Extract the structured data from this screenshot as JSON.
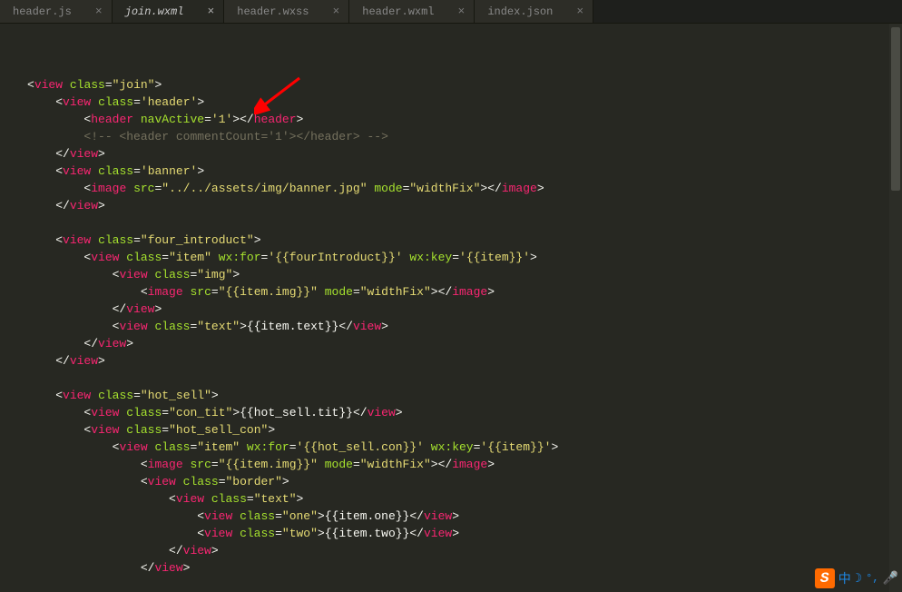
{
  "tabs": [
    {
      "label": "header.js",
      "active": false
    },
    {
      "label": "join.wxml",
      "active": true
    },
    {
      "label": "header.wxss",
      "active": false
    },
    {
      "label": "header.wxml",
      "active": false
    },
    {
      "label": "index.json",
      "active": false
    }
  ],
  "code_lines": [
    {
      "indent": 0,
      "tokens": [
        {
          "t": "tag-angle",
          "v": "<"
        },
        {
          "t": "tag-name",
          "v": "view"
        },
        {
          "t": "text",
          "v": " "
        },
        {
          "t": "attr-name",
          "v": "class"
        },
        {
          "t": "eq",
          "v": "="
        },
        {
          "t": "string",
          "v": "\"join\""
        },
        {
          "t": "tag-angle",
          "v": ">"
        }
      ]
    },
    {
      "indent": 1,
      "tokens": [
        {
          "t": "tag-angle",
          "v": "<"
        },
        {
          "t": "tag-name",
          "v": "view"
        },
        {
          "t": "text",
          "v": " "
        },
        {
          "t": "attr-name",
          "v": "class"
        },
        {
          "t": "eq",
          "v": "="
        },
        {
          "t": "string",
          "v": "'header'"
        },
        {
          "t": "tag-angle",
          "v": ">"
        }
      ]
    },
    {
      "indent": 2,
      "tokens": [
        {
          "t": "tag-angle",
          "v": "<"
        },
        {
          "t": "tag-name",
          "v": "header"
        },
        {
          "t": "text",
          "v": " "
        },
        {
          "t": "attr-name",
          "v": "navActive"
        },
        {
          "t": "eq",
          "v": "="
        },
        {
          "t": "string",
          "v": "'1'"
        },
        {
          "t": "tag-angle",
          "v": ">"
        },
        {
          "t": "tag-angle",
          "v": "</"
        },
        {
          "t": "tag-name",
          "v": "header"
        },
        {
          "t": "tag-angle",
          "v": ">"
        }
      ]
    },
    {
      "indent": 2,
      "tokens": [
        {
          "t": "comment",
          "v": "<!-- <header commentCount='1'></header> -->"
        }
      ]
    },
    {
      "indent": 1,
      "tokens": [
        {
          "t": "tag-angle",
          "v": "</"
        },
        {
          "t": "tag-name",
          "v": "view"
        },
        {
          "t": "tag-angle",
          "v": ">"
        }
      ]
    },
    {
      "indent": 1,
      "tokens": [
        {
          "t": "tag-angle",
          "v": "<"
        },
        {
          "t": "tag-name",
          "v": "view"
        },
        {
          "t": "text",
          "v": " "
        },
        {
          "t": "attr-name",
          "v": "class"
        },
        {
          "t": "eq",
          "v": "="
        },
        {
          "t": "string",
          "v": "'banner'"
        },
        {
          "t": "tag-angle",
          "v": ">"
        }
      ]
    },
    {
      "indent": 2,
      "tokens": [
        {
          "t": "tag-angle",
          "v": "<"
        },
        {
          "t": "tag-name",
          "v": "image"
        },
        {
          "t": "text",
          "v": " "
        },
        {
          "t": "attr-name",
          "v": "src"
        },
        {
          "t": "eq",
          "v": "="
        },
        {
          "t": "string",
          "v": "\"../../assets/img/banner.jpg\""
        },
        {
          "t": "text",
          "v": " "
        },
        {
          "t": "attr-name",
          "v": "mode"
        },
        {
          "t": "eq",
          "v": "="
        },
        {
          "t": "string",
          "v": "\"widthFix\""
        },
        {
          "t": "tag-angle",
          "v": ">"
        },
        {
          "t": "tag-angle",
          "v": "</"
        },
        {
          "t": "tag-name",
          "v": "image"
        },
        {
          "t": "tag-angle",
          "v": ">"
        }
      ]
    },
    {
      "indent": 1,
      "tokens": [
        {
          "t": "tag-angle",
          "v": "</"
        },
        {
          "t": "tag-name",
          "v": "view"
        },
        {
          "t": "tag-angle",
          "v": ">"
        }
      ]
    },
    {
      "indent": 0,
      "tokens": []
    },
    {
      "indent": 1,
      "tokens": [
        {
          "t": "tag-angle",
          "v": "<"
        },
        {
          "t": "tag-name",
          "v": "view"
        },
        {
          "t": "text",
          "v": " "
        },
        {
          "t": "attr-name",
          "v": "class"
        },
        {
          "t": "eq",
          "v": "="
        },
        {
          "t": "string",
          "v": "\"four_introduct\""
        },
        {
          "t": "tag-angle",
          "v": ">"
        }
      ]
    },
    {
      "indent": 2,
      "tokens": [
        {
          "t": "tag-angle",
          "v": "<"
        },
        {
          "t": "tag-name",
          "v": "view"
        },
        {
          "t": "text",
          "v": " "
        },
        {
          "t": "attr-name",
          "v": "class"
        },
        {
          "t": "eq",
          "v": "="
        },
        {
          "t": "string",
          "v": "\"item\""
        },
        {
          "t": "text",
          "v": " "
        },
        {
          "t": "attr-name",
          "v": "wx:for"
        },
        {
          "t": "eq",
          "v": "="
        },
        {
          "t": "string",
          "v": "'{{fourIntroduct}}'"
        },
        {
          "t": "text",
          "v": " "
        },
        {
          "t": "attr-name",
          "v": "wx:key"
        },
        {
          "t": "eq",
          "v": "="
        },
        {
          "t": "string",
          "v": "'{{item}}'"
        },
        {
          "t": "tag-angle",
          "v": ">"
        }
      ]
    },
    {
      "indent": 3,
      "tokens": [
        {
          "t": "tag-angle",
          "v": "<"
        },
        {
          "t": "tag-name",
          "v": "view"
        },
        {
          "t": "text",
          "v": " "
        },
        {
          "t": "attr-name",
          "v": "class"
        },
        {
          "t": "eq",
          "v": "="
        },
        {
          "t": "string",
          "v": "\"img\""
        },
        {
          "t": "tag-angle",
          "v": ">"
        }
      ]
    },
    {
      "indent": 4,
      "tokens": [
        {
          "t": "tag-angle",
          "v": "<"
        },
        {
          "t": "tag-name",
          "v": "image"
        },
        {
          "t": "text",
          "v": " "
        },
        {
          "t": "attr-name",
          "v": "src"
        },
        {
          "t": "eq",
          "v": "="
        },
        {
          "t": "string",
          "v": "\"{{item.img}}\""
        },
        {
          "t": "text",
          "v": " "
        },
        {
          "t": "attr-name",
          "v": "mode"
        },
        {
          "t": "eq",
          "v": "="
        },
        {
          "t": "string",
          "v": "\"widthFix\""
        },
        {
          "t": "tag-angle",
          "v": ">"
        },
        {
          "t": "tag-angle",
          "v": "</"
        },
        {
          "t": "tag-name",
          "v": "image"
        },
        {
          "t": "tag-angle",
          "v": ">"
        }
      ]
    },
    {
      "indent": 3,
      "tokens": [
        {
          "t": "tag-angle",
          "v": "</"
        },
        {
          "t": "tag-name",
          "v": "view"
        },
        {
          "t": "tag-angle",
          "v": ">"
        }
      ]
    },
    {
      "indent": 3,
      "tokens": [
        {
          "t": "tag-angle",
          "v": "<"
        },
        {
          "t": "tag-name",
          "v": "view"
        },
        {
          "t": "text",
          "v": " "
        },
        {
          "t": "attr-name",
          "v": "class"
        },
        {
          "t": "eq",
          "v": "="
        },
        {
          "t": "string",
          "v": "\"text\""
        },
        {
          "t": "tag-angle",
          "v": ">"
        },
        {
          "t": "mustache",
          "v": "{{item.text}}"
        },
        {
          "t": "tag-angle",
          "v": "</"
        },
        {
          "t": "tag-name",
          "v": "view"
        },
        {
          "t": "tag-angle",
          "v": ">"
        }
      ]
    },
    {
      "indent": 2,
      "tokens": [
        {
          "t": "tag-angle",
          "v": "</"
        },
        {
          "t": "tag-name",
          "v": "view"
        },
        {
          "t": "tag-angle",
          "v": ">"
        }
      ]
    },
    {
      "indent": 1,
      "tokens": [
        {
          "t": "tag-angle",
          "v": "</"
        },
        {
          "t": "tag-name",
          "v": "view"
        },
        {
          "t": "tag-angle",
          "v": ">"
        }
      ]
    },
    {
      "indent": 0,
      "tokens": []
    },
    {
      "indent": 1,
      "tokens": [
        {
          "t": "tag-angle",
          "v": "<"
        },
        {
          "t": "tag-name",
          "v": "view"
        },
        {
          "t": "text",
          "v": " "
        },
        {
          "t": "attr-name",
          "v": "class"
        },
        {
          "t": "eq",
          "v": "="
        },
        {
          "t": "string",
          "v": "\"hot_sell\""
        },
        {
          "t": "tag-angle",
          "v": ">"
        }
      ]
    },
    {
      "indent": 2,
      "tokens": [
        {
          "t": "tag-angle",
          "v": "<"
        },
        {
          "t": "tag-name",
          "v": "view"
        },
        {
          "t": "text",
          "v": " "
        },
        {
          "t": "attr-name",
          "v": "class"
        },
        {
          "t": "eq",
          "v": "="
        },
        {
          "t": "string",
          "v": "\"con_tit\""
        },
        {
          "t": "tag-angle",
          "v": ">"
        },
        {
          "t": "mustache",
          "v": "{{hot_sell.tit}}"
        },
        {
          "t": "tag-angle",
          "v": "</"
        },
        {
          "t": "tag-name",
          "v": "view"
        },
        {
          "t": "tag-angle",
          "v": ">"
        }
      ]
    },
    {
      "indent": 2,
      "tokens": [
        {
          "t": "tag-angle",
          "v": "<"
        },
        {
          "t": "tag-name",
          "v": "view"
        },
        {
          "t": "text",
          "v": " "
        },
        {
          "t": "attr-name",
          "v": "class"
        },
        {
          "t": "eq",
          "v": "="
        },
        {
          "t": "string",
          "v": "\"hot_sell_con\""
        },
        {
          "t": "tag-angle",
          "v": ">"
        }
      ]
    },
    {
      "indent": 3,
      "tokens": [
        {
          "t": "tag-angle",
          "v": "<"
        },
        {
          "t": "tag-name",
          "v": "view"
        },
        {
          "t": "text",
          "v": " "
        },
        {
          "t": "attr-name",
          "v": "class"
        },
        {
          "t": "eq",
          "v": "="
        },
        {
          "t": "string",
          "v": "\"item\""
        },
        {
          "t": "text",
          "v": " "
        },
        {
          "t": "attr-name",
          "v": "wx:for"
        },
        {
          "t": "eq",
          "v": "="
        },
        {
          "t": "string",
          "v": "'{{hot_sell.con}}'"
        },
        {
          "t": "text",
          "v": " "
        },
        {
          "t": "attr-name",
          "v": "wx:key"
        },
        {
          "t": "eq",
          "v": "="
        },
        {
          "t": "string",
          "v": "'{{item}}'"
        },
        {
          "t": "tag-angle",
          "v": ">"
        }
      ]
    },
    {
      "indent": 4,
      "tokens": [
        {
          "t": "tag-angle",
          "v": "<"
        },
        {
          "t": "tag-name",
          "v": "image"
        },
        {
          "t": "text",
          "v": " "
        },
        {
          "t": "attr-name",
          "v": "src"
        },
        {
          "t": "eq",
          "v": "="
        },
        {
          "t": "string",
          "v": "\"{{item.img}}\""
        },
        {
          "t": "text",
          "v": " "
        },
        {
          "t": "attr-name",
          "v": "mode"
        },
        {
          "t": "eq",
          "v": "="
        },
        {
          "t": "string",
          "v": "\"widthFix\""
        },
        {
          "t": "tag-angle",
          "v": ">"
        },
        {
          "t": "tag-angle",
          "v": "</"
        },
        {
          "t": "tag-name",
          "v": "image"
        },
        {
          "t": "tag-angle",
          "v": ">"
        }
      ]
    },
    {
      "indent": 4,
      "tokens": [
        {
          "t": "tag-angle",
          "v": "<"
        },
        {
          "t": "tag-name",
          "v": "view"
        },
        {
          "t": "text",
          "v": " "
        },
        {
          "t": "attr-name",
          "v": "class"
        },
        {
          "t": "eq",
          "v": "="
        },
        {
          "t": "string",
          "v": "\"border\""
        },
        {
          "t": "tag-angle",
          "v": ">"
        }
      ]
    },
    {
      "indent": 5,
      "tokens": [
        {
          "t": "tag-angle",
          "v": "<"
        },
        {
          "t": "tag-name",
          "v": "view"
        },
        {
          "t": "text",
          "v": " "
        },
        {
          "t": "attr-name",
          "v": "class"
        },
        {
          "t": "eq",
          "v": "="
        },
        {
          "t": "string",
          "v": "\"text\""
        },
        {
          "t": "tag-angle",
          "v": ">"
        }
      ]
    },
    {
      "indent": 6,
      "tokens": [
        {
          "t": "tag-angle",
          "v": "<"
        },
        {
          "t": "tag-name",
          "v": "view"
        },
        {
          "t": "text",
          "v": " "
        },
        {
          "t": "attr-name",
          "v": "class"
        },
        {
          "t": "eq",
          "v": "="
        },
        {
          "t": "string",
          "v": "\"one\""
        },
        {
          "t": "tag-angle",
          "v": ">"
        },
        {
          "t": "mustache",
          "v": "{{item.one}}"
        },
        {
          "t": "tag-angle",
          "v": "</"
        },
        {
          "t": "tag-name",
          "v": "view"
        },
        {
          "t": "tag-angle",
          "v": ">"
        }
      ]
    },
    {
      "indent": 6,
      "tokens": [
        {
          "t": "tag-angle",
          "v": "<"
        },
        {
          "t": "tag-name",
          "v": "view"
        },
        {
          "t": "text",
          "v": " "
        },
        {
          "t": "attr-name",
          "v": "class"
        },
        {
          "t": "eq",
          "v": "="
        },
        {
          "t": "string",
          "v": "\"two\""
        },
        {
          "t": "tag-angle",
          "v": ">"
        },
        {
          "t": "mustache",
          "v": "{{item.two}}"
        },
        {
          "t": "tag-angle",
          "v": "</"
        },
        {
          "t": "tag-name",
          "v": "view"
        },
        {
          "t": "tag-angle",
          "v": ">"
        }
      ]
    },
    {
      "indent": 5,
      "tokens": [
        {
          "t": "tag-angle",
          "v": "</"
        },
        {
          "t": "tag-name",
          "v": "view"
        },
        {
          "t": "tag-angle",
          "v": ">"
        }
      ]
    },
    {
      "indent": 4,
      "tokens": [
        {
          "t": "tag-angle",
          "v": "</"
        },
        {
          "t": "tag-name",
          "v": "view"
        },
        {
          "t": "tag-angle",
          "v": ">"
        }
      ]
    }
  ],
  "ime": {
    "logo": "S",
    "han": "中",
    "moon": "☽",
    "sep": "°,",
    "mic": "🎤"
  }
}
